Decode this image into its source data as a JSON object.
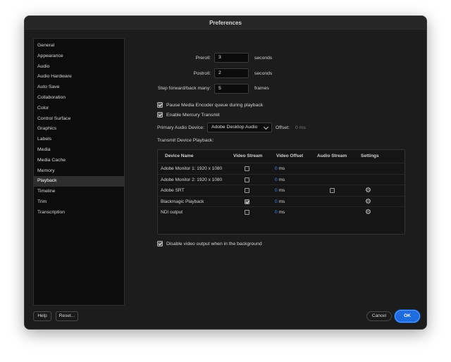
{
  "window": {
    "title": "Preferences"
  },
  "sidebar": {
    "items": [
      {
        "label": "General",
        "selected": false
      },
      {
        "label": "Appearance",
        "selected": false
      },
      {
        "label": "Audio",
        "selected": false
      },
      {
        "label": "Audio Hardware",
        "selected": false
      },
      {
        "label": "Auto Save",
        "selected": false
      },
      {
        "label": "Collaboration",
        "selected": false
      },
      {
        "label": "Color",
        "selected": false
      },
      {
        "label": "Control Surface",
        "selected": false
      },
      {
        "label": "Graphics",
        "selected": false
      },
      {
        "label": "Labels",
        "selected": false
      },
      {
        "label": "Media",
        "selected": false
      },
      {
        "label": "Media Cache",
        "selected": false
      },
      {
        "label": "Memory",
        "selected": false
      },
      {
        "label": "Playback",
        "selected": true
      },
      {
        "label": "Timeline",
        "selected": false
      },
      {
        "label": "Trim",
        "selected": false
      },
      {
        "label": "Transcription",
        "selected": false
      }
    ]
  },
  "playback": {
    "preroll": {
      "label": "Preroll:",
      "value": "3",
      "unit": "seconds"
    },
    "postroll": {
      "label": "Postroll:",
      "value": "2",
      "unit": "seconds"
    },
    "step": {
      "label": "Step forward/back many:",
      "value": "5",
      "unit": "frames"
    },
    "pause_encoder": {
      "label": "Pause Media Encoder queue during playback",
      "checked": true
    },
    "mercury": {
      "label": "Enable Mercury Transmit",
      "checked": true
    },
    "audio_device": {
      "label": "Primary Audio Device:",
      "value": "Adobe Desktop Audio",
      "offset_label": "Offset:",
      "offset_value": "0 ms"
    },
    "transmit_title": "Transmit Device Playback:",
    "table": {
      "headers": {
        "device": "Device Name",
        "video_stream": "Video Stream",
        "video_offset": "Video Offset",
        "audio_stream": "Audio Stream",
        "settings": "Settings"
      },
      "rows": [
        {
          "device": "Adobe Monitor 1: 1920 x 1080",
          "video": false,
          "offset": "0",
          "unit": "ms",
          "audio": null,
          "settings": false
        },
        {
          "device": "Adobe Monitor 2: 1920 x 1080",
          "video": false,
          "offset": "0",
          "unit": "ms",
          "audio": null,
          "settings": false
        },
        {
          "device": "Adobe SRT",
          "video": false,
          "offset": "0",
          "unit": "ms",
          "audio": false,
          "settings": true
        },
        {
          "device": "Blackmagic Playback",
          "video": true,
          "offset": "0",
          "unit": "ms",
          "audio": null,
          "settings": true
        },
        {
          "device": "NDI output",
          "video": false,
          "offset": "0",
          "unit": "ms",
          "audio": null,
          "settings": true
        }
      ]
    },
    "disable_bg": {
      "label": "Disable video output when in the background",
      "checked": true
    }
  },
  "footer": {
    "help": "Help",
    "reset": "Reset...",
    "cancel": "Cancel",
    "ok": "OK"
  },
  "colors": {
    "accent": "#1f6be0",
    "link_value": "#3d8bff",
    "background": "#1c1c1c"
  },
  "icons": {
    "settings": "gear-icon",
    "dropdown": "chevron-down-icon"
  }
}
